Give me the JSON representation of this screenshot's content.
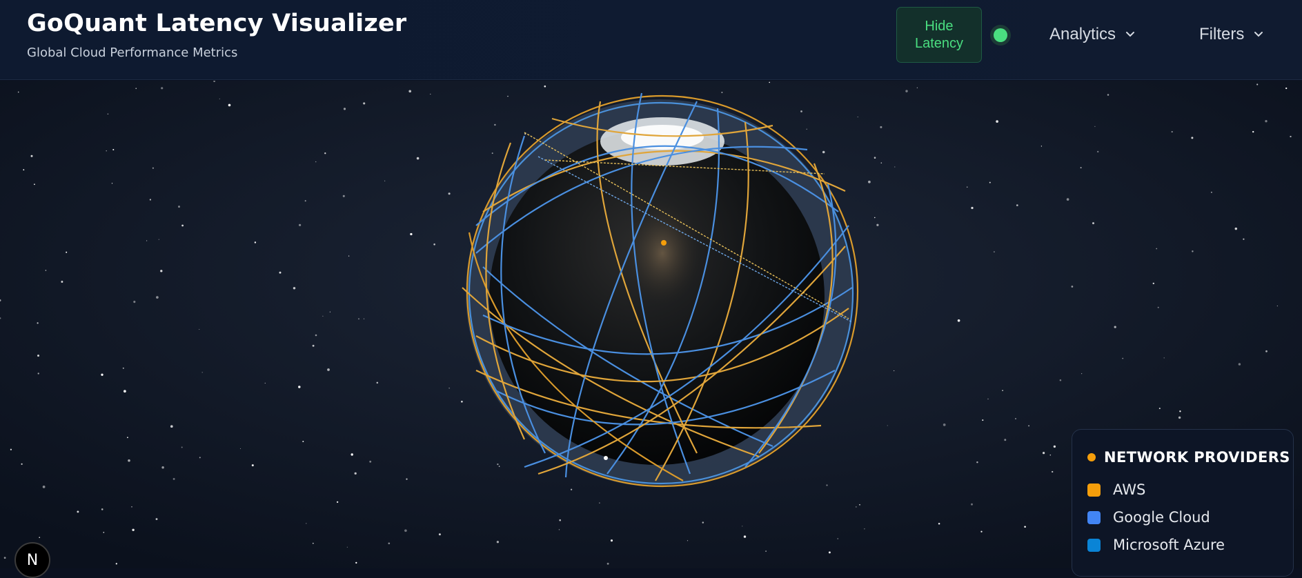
{
  "header": {
    "title": "GoQuant Latency Visualizer",
    "subtitle": "Global Cloud Performance Metrics",
    "hide_latency_label": "Hide Latency",
    "status_color": "#4ade80",
    "menus": [
      {
        "label": "Analytics",
        "icon": "chevron-down-icon"
      },
      {
        "label": "Filters",
        "icon": "chevron-down-icon"
      }
    ]
  },
  "legend": {
    "title": "NETWORK PROVIDERS",
    "items": [
      {
        "label": "AWS",
        "color": "#f59e0b"
      },
      {
        "label": "Google Cloud",
        "color": "#4285f4"
      },
      {
        "label": "Microsoft Azure",
        "color": "#0a84d6"
      }
    ]
  },
  "badge": {
    "label": "N"
  },
  "colors": {
    "background": "#0b1120",
    "aws": "#f59e0b",
    "gcp": "#4285f4",
    "azure": "#0a84d6",
    "accent": "#4ade80"
  }
}
